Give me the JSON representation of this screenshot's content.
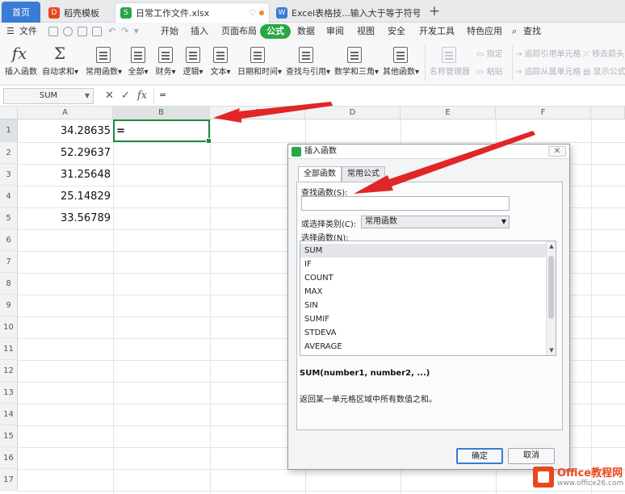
{
  "tabs": {
    "home": "首页",
    "template": "稻壳模板",
    "doc": "日常工作文件.xlsx",
    "excel": "Excel表格技...输入大于等于符号"
  },
  "menu": {
    "file": "文件",
    "items": [
      "开始",
      "插入",
      "页面布局",
      "公式",
      "数据",
      "审阅",
      "视图",
      "安全",
      "开发工具",
      "特色应用"
    ],
    "search": "查找",
    "active": "公式"
  },
  "ribbon": {
    "insert_function": "插入函数",
    "autosum": "自动求和",
    "common": "常用函数",
    "all": "全部",
    "finance": "财务",
    "logic": "逻辑",
    "text": "文本",
    "datetime": "日期和时间",
    "lookup": "查找与引用",
    "math": "数学和三角",
    "other": "其他函数",
    "name_manager": "名称管理器",
    "paste": "粘贴",
    "specify": "指定",
    "trace_precedents": "追踪引用单元格",
    "trace_dependents": "追踪从属单元格",
    "remove_arrows": "移去箭头",
    "show_formulas": "显示公式"
  },
  "formula_bar": {
    "name_box": "SUM",
    "cancel": "✕",
    "confirm": "✓",
    "fx": "fx",
    "content": "="
  },
  "sheet": {
    "columns": [
      "A",
      "B",
      "C",
      "D",
      "E",
      "F"
    ],
    "rows": [
      "1",
      "2",
      "3",
      "4",
      "5",
      "6",
      "7",
      "8",
      "9",
      "10",
      "11",
      "12",
      "13",
      "14",
      "15",
      "16",
      "17"
    ],
    "a_values": [
      "34.28635",
      "52.29637",
      "31.25648",
      "25.14829",
      "33.56789"
    ],
    "b1": "="
  },
  "dialog": {
    "title": "插入函数",
    "tab_all": "全部函数",
    "tab_common": "常用公式",
    "search_label": "查找函数(S):",
    "category_label": "或选择类别(C):",
    "category_value": "常用函数",
    "select_label": "选择函数(N):",
    "functions": [
      "SUM",
      "IF",
      "COUNT",
      "MAX",
      "SIN",
      "SUMIF",
      "STDEVA",
      "AVERAGE"
    ],
    "signature": "SUM(number1, number2, ...)",
    "description": "返回某一单元格区域中所有数值之和。",
    "ok": "确定",
    "cancel": "取消"
  },
  "watermark": {
    "name": "Office教程网",
    "url": "www.office26.com"
  },
  "colors": {
    "accent_green": "#28a745",
    "arrow_red": "#e02626",
    "tab_blue": "#3a7bd5"
  }
}
